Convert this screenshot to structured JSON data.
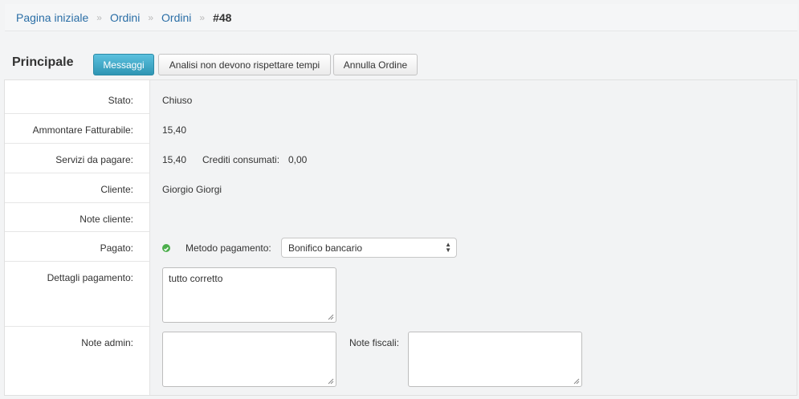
{
  "breadcrumb": {
    "items": [
      "Pagina iniziale",
      "Ordini",
      "Ordini"
    ],
    "separator": "»",
    "current": "#48"
  },
  "section": {
    "title": "Principale"
  },
  "actions": {
    "messages": "Messaggi",
    "analysis": "Analisi non devono rispettare tempi",
    "cancel": "Annulla Ordine"
  },
  "fields": {
    "stato": {
      "label": "Stato:",
      "value": "Chiuso"
    },
    "ammontare": {
      "label": "Ammontare Fatturabile:",
      "value": "15,40"
    },
    "servizi": {
      "label": "Servizi da pagare:",
      "value": "15,40",
      "crediti_label": "Crediti consumati:",
      "crediti_value": "0,00"
    },
    "cliente": {
      "label": "Cliente:",
      "value": "Giorgio Giorgi"
    },
    "note_cliente": {
      "label": "Note cliente:"
    },
    "pagato": {
      "label": "Pagato:",
      "metodo_label": "Metodo pagamento:",
      "metodo_value": "Bonifico bancario"
    },
    "dettagli": {
      "label": "Dettagli pagamento:",
      "value": "tutto corretto"
    },
    "note_admin": {
      "label": "Note admin:"
    },
    "note_fiscali": {
      "label": "Note fiscali:"
    }
  },
  "colors": {
    "primary": "#3aa6c8",
    "link": "#2a6ea6",
    "success": "#4cae4c"
  }
}
